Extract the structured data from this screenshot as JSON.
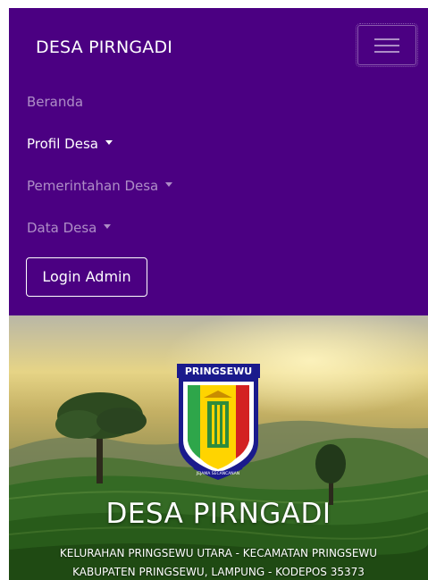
{
  "navbar": {
    "brand": "DESA PIRNGADI",
    "toggler_icon": "hamburger-menu-icon",
    "bg_color": "#4b0082",
    "items": [
      {
        "label": "Beranda",
        "dropdown": false
      },
      {
        "label": "Profil Desa",
        "dropdown": true
      },
      {
        "label": "Pemerintahan Desa",
        "dropdown": true
      },
      {
        "label": "Data Desa",
        "dropdown": true
      }
    ],
    "login_label": "Login Admin"
  },
  "hero": {
    "logo_banner": "PRINGSEWU",
    "logo_motto": "JEJAMA SECANCANAN",
    "title": "DESA PIRNGADI",
    "line1": "KELURAHAN PRINGSEWU UTARA - KECAMATAN PRINGSEWU",
    "line2": "KABUPATEN PRINGSEWU, LAMPUNG - KODEPOS 35373"
  }
}
